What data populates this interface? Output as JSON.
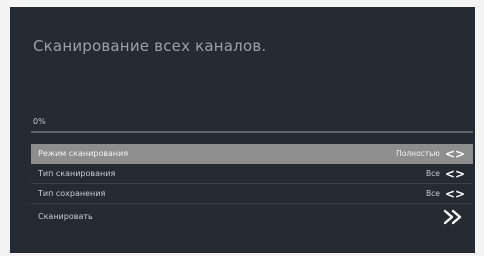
{
  "screen": {
    "title": "Сканирование всех каналов."
  },
  "progress": {
    "label": "0%",
    "value": 0
  },
  "menu": {
    "items": [
      {
        "label": "Режим сканирования",
        "value": "Полностью",
        "control": "<>",
        "selected": true
      },
      {
        "label": "Тип сканирования",
        "value": "Все",
        "control": "<>",
        "selected": false
      },
      {
        "label": "Тип сохранения",
        "value": "Все",
        "control": "<>",
        "selected": false
      },
      {
        "label": "Сканировать",
        "value": "",
        "control": "double-chevron-right-icon",
        "selected": false
      }
    ]
  },
  "colors": {
    "background": "#262b33",
    "selected_row": "#8e8e8e",
    "title_text": "#9aa0a8"
  }
}
